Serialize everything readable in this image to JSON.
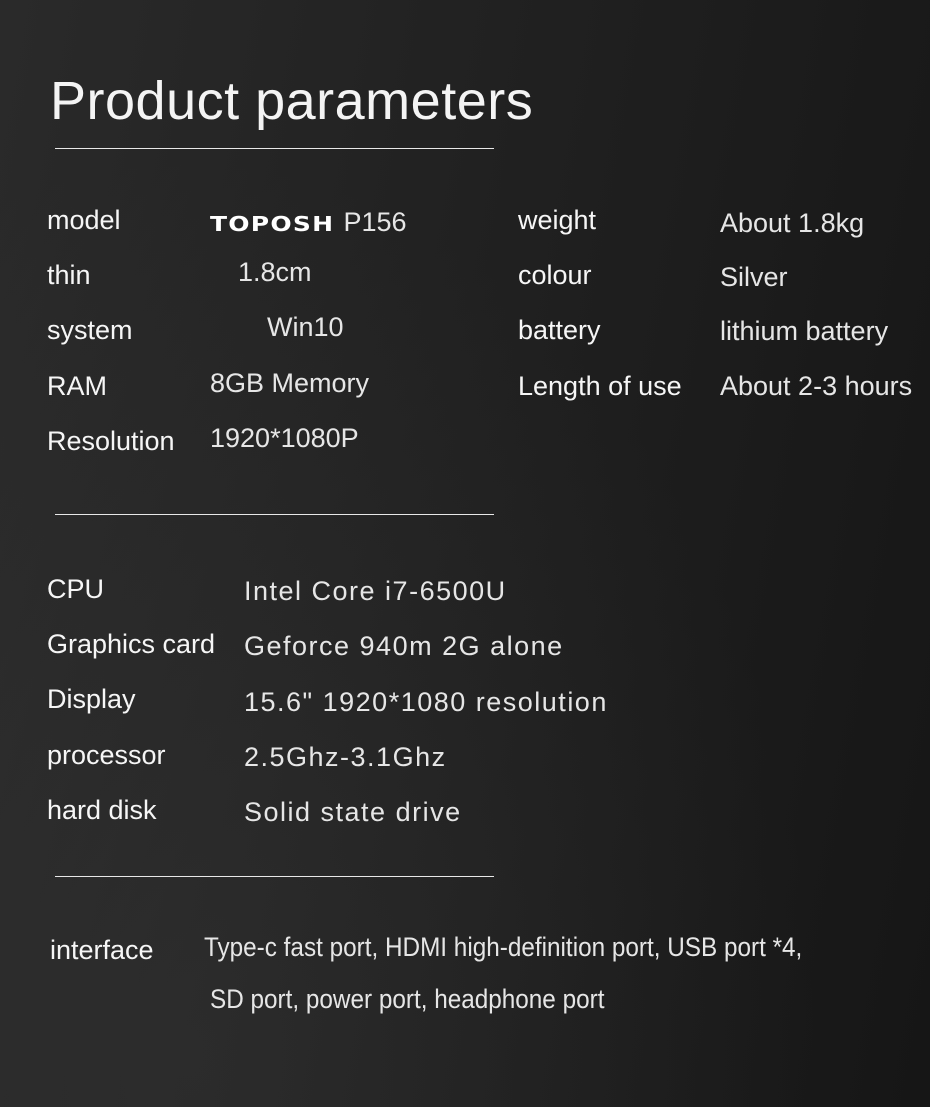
{
  "page": {
    "title": "Product parameters"
  },
  "basic_specs": {
    "left": [
      {
        "label": "model",
        "brand": "TOPOSH",
        "value": "P156"
      },
      {
        "label": "thin",
        "value": "1.8cm"
      },
      {
        "label": "system",
        "value": "Win10"
      },
      {
        "label": "RAM",
        "value": "8GB Memory"
      },
      {
        "label": "Resolution",
        "value": "1920*1080P"
      }
    ],
    "right": [
      {
        "label": "weight",
        "value": "About 1.8kg"
      },
      {
        "label": "colour",
        "value": "Silver"
      },
      {
        "label": "battery",
        "value": "lithium battery"
      },
      {
        "label": "Length of use",
        "value": "About 2-3 hours"
      }
    ]
  },
  "hardware_specs": [
    {
      "label": "CPU",
      "value": "Intel Core i7-6500U"
    },
    {
      "label": "Graphics card",
      "value": "Geforce 940m  2G alone"
    },
    {
      "label": "Display",
      "value": "15.6\" 1920*1080 resolution"
    },
    {
      "label": "processor",
      "value": "2.5Ghz-3.1Ghz"
    },
    {
      "label": "hard disk",
      "value": "Solid state drive"
    }
  ],
  "interface": {
    "label": "interface",
    "lines": [
      "Type-c fast port, HDMI high-definition port, USB port *4,",
      "SD port, power port, headphone port"
    ]
  }
}
